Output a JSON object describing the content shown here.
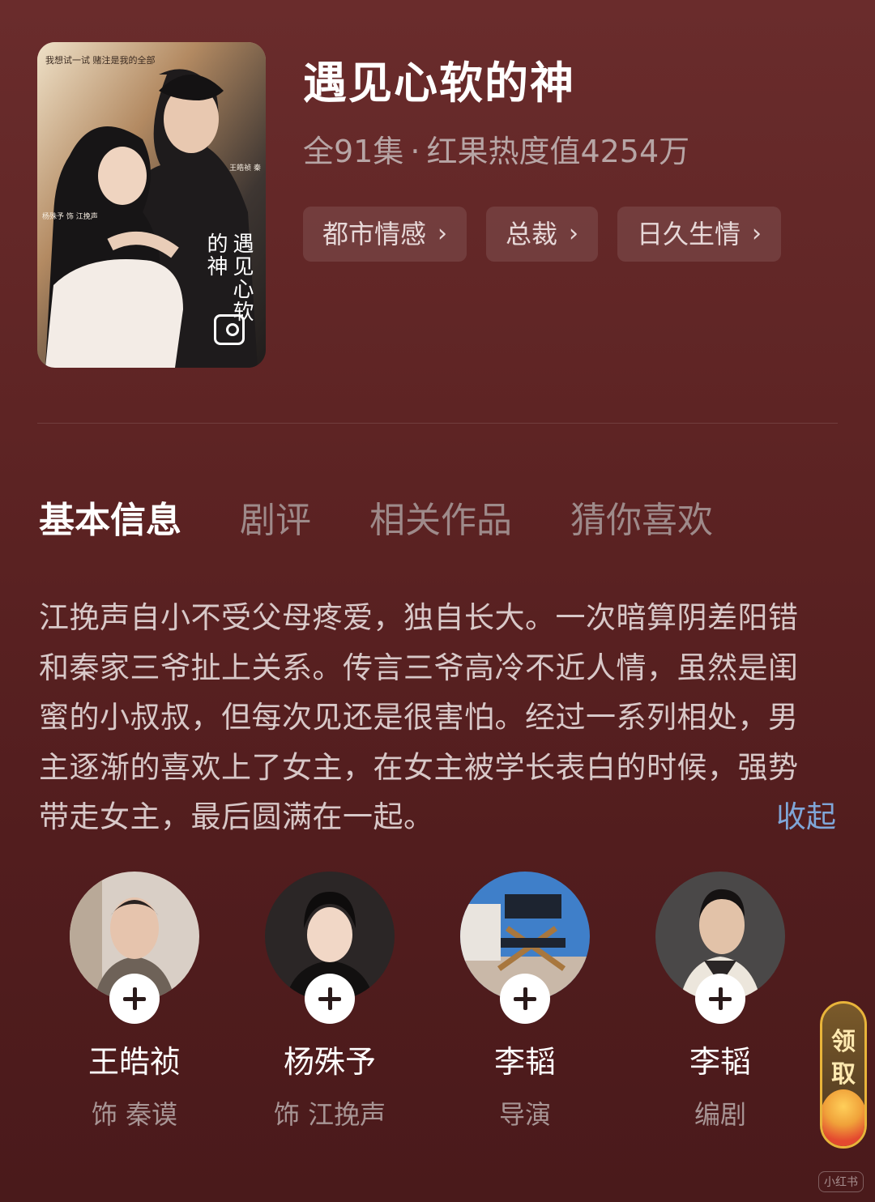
{
  "drama": {
    "title": "遇见心软的神",
    "episodes": "全91集",
    "separator": "·",
    "heat": "红果热度值4254万",
    "tags": [
      "都市情感",
      "总裁",
      "日久生情"
    ]
  },
  "poster": {
    "tagline": "我想试一试 赌注是我的全部",
    "credit_left": "杨殊予 饰 江挽声",
    "credit_right": "王皓祯 秦",
    "logo_text": "遇见心软的神"
  },
  "tabs": [
    {
      "label": "基本信息",
      "active": true
    },
    {
      "label": "剧评",
      "active": false
    },
    {
      "label": "相关作品",
      "active": false
    },
    {
      "label": "猜你喜欢",
      "active": false
    }
  ],
  "synopsis": {
    "text": "江挽声自小不受父母疼爱，独自长大。一次暗算阴差阳错和秦家三爷扯上关系。传言三爷高冷不近人情，虽然是闺蜜的小叔叔，但每次见还是很害怕。经过一系列相处，男主逐渐的喜欢上了女主，在女主被学长表白的时候，强势带走女主，最后圆满在一起。",
    "collapse_label": "收起"
  },
  "cast": [
    {
      "name": "王皓祯",
      "role": "饰 秦谟"
    },
    {
      "name": "杨殊予",
      "role": "饰 江挽声"
    },
    {
      "name": "李韬",
      "role": "导演"
    },
    {
      "name": "李韬",
      "role": "编剧"
    }
  ],
  "float_widget": {
    "label": "领取"
  },
  "watermark": "小红书",
  "colors": {
    "background": "#5e2424",
    "link": "#7fa6d8",
    "muted": "#b7a5a5"
  }
}
